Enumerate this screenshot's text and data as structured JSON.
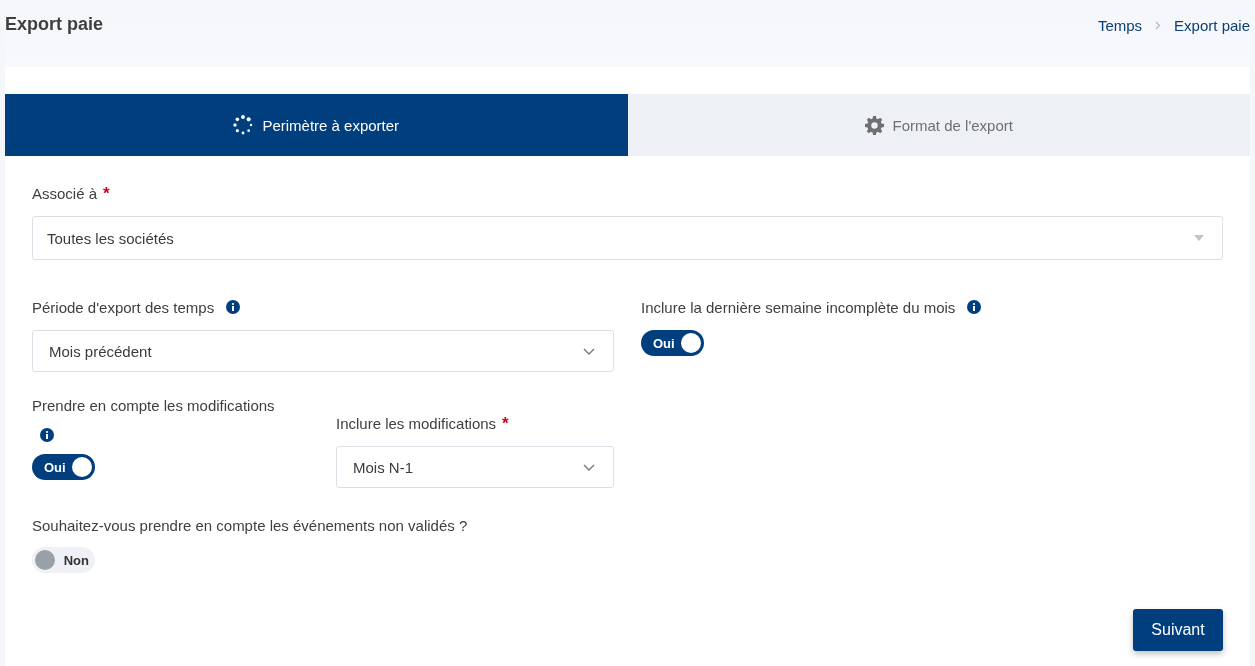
{
  "page": {
    "title": "Export paie"
  },
  "breadcrumb": [
    {
      "label": "Temps"
    },
    {
      "label": "Export paie"
    }
  ],
  "steps": [
    {
      "label": "Perimètre à exporter",
      "selected": true
    },
    {
      "label": "Format de l'export",
      "selected": false
    }
  ],
  "associe": {
    "label": "Associé à",
    "required_mark": "*",
    "kind": "combobox",
    "value": "Toutes les sociétés"
  },
  "periode": {
    "label": "Période d'export des temps",
    "info": true,
    "kind": "select",
    "value": "Mois précédent"
  },
  "derniere_semaine": {
    "label": "Inclure la dernière semaine incomplète du mois",
    "info": true,
    "on": true,
    "state_label": "Oui"
  },
  "prendre_modifications": {
    "label": "Prendre en compte les modifications",
    "info": true,
    "on": true,
    "state_label": "Oui"
  },
  "inclure_modifications": {
    "label": "Inclure les modifications",
    "required_mark": "*",
    "kind": "select",
    "value": "Mois N-1"
  },
  "evenements": {
    "label": "Souhaitez-vous prendre en compte les événements non validés ?",
    "on": false,
    "state_label": "Non"
  },
  "next_button": {
    "label": "Suivant"
  }
}
